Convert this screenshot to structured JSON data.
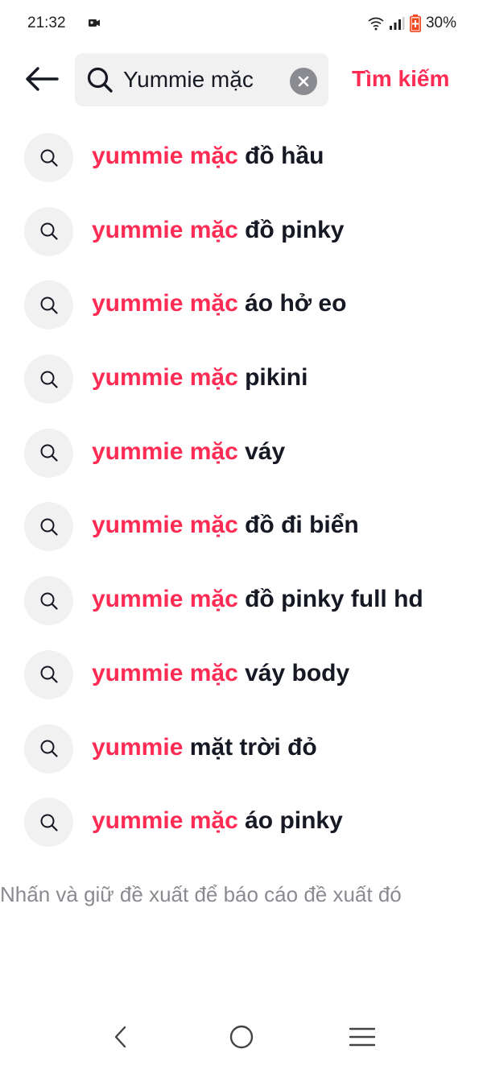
{
  "status_bar": {
    "time": "21:32",
    "battery": "30%",
    "icons": [
      "screen-record-icon",
      "wifi-icon",
      "signal-icon",
      "battery-icon"
    ]
  },
  "search": {
    "value": "Yummie mặc",
    "submit_label": "Tìm kiếm",
    "icons": [
      "back-arrow-icon",
      "search-icon",
      "clear-icon"
    ]
  },
  "suggestions": [
    {
      "match": "yummie mặc",
      "rest": " đồ hầu"
    },
    {
      "match": "yummie mặc",
      "rest": " đồ pinky"
    },
    {
      "match": "yummie mặc",
      "rest": " áo hở eo"
    },
    {
      "match": "yummie mặc",
      "rest": " pikini"
    },
    {
      "match": "yummie mặc",
      "rest": " váy"
    },
    {
      "match": "yummie mặc",
      "rest": " đồ đi biển"
    },
    {
      "match": "yummie mặc",
      "rest": " đồ pinky full hd"
    },
    {
      "match": "yummie mặc",
      "rest": " váy body"
    },
    {
      "match": "yummie",
      "rest": " mặt trời đỏ"
    },
    {
      "match": "yummie mặc",
      "rest": " áo pinky"
    }
  ],
  "hint": "Nhấn và giữ đề xuất để báo cáo đề xuất đó",
  "nav_bar": {
    "icons": [
      "back-nav-icon",
      "home-nav-icon",
      "menu-nav-icon"
    ]
  },
  "colors": {
    "accent": "#fe2c55",
    "text": "#161823",
    "muted": "#8a8b91",
    "field_bg": "#f1f1f2",
    "battery": "#f04a23"
  }
}
